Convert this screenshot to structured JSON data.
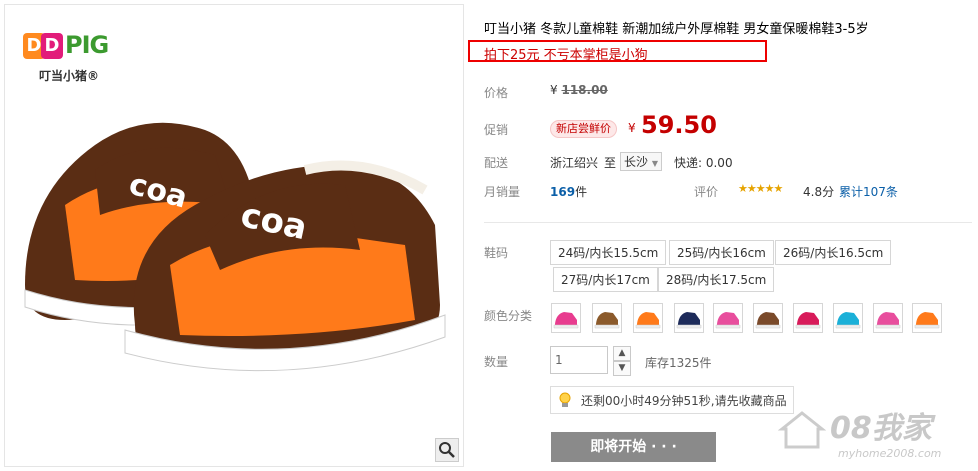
{
  "product": {
    "title": "叮当小猪 冬款儿童棉鞋 新潮加绒户外厚棉鞋 男女童保暖棉鞋3-5岁",
    "promo": "拍下25元 不亏本掌柜是小狗"
  },
  "brand": {
    "letters": "PIG",
    "subtitle": "叮当小猪",
    "reg": "®",
    "colors": {
      "d1": "#ff8a1f",
      "d2": "#e21c7a",
      "word": "#3c9a2f"
    }
  },
  "image": {
    "shoe_text": "coa"
  },
  "price": {
    "label": "价格",
    "currency": "¥",
    "original": "118.00"
  },
  "promo_price": {
    "label": "促销",
    "badge": "新店尝鲜价",
    "currency": "¥",
    "value": "59.50"
  },
  "shipping": {
    "label": "配送",
    "origin": "浙江绍兴",
    "to": "至",
    "destination": "长沙",
    "express": "快递: 0.00"
  },
  "sales": {
    "label": "月销量",
    "count": "169",
    "unit": "件",
    "rating_label": "评价",
    "stars": "★★★★★",
    "rating": "4.8分",
    "reviews": "累计107条"
  },
  "size": {
    "label": "鞋码",
    "options": [
      "24码/内长15.5cm",
      "25码/内长16cm",
      "26码/内长16.5cm",
      "27码/内长17cm",
      "28码/内长17.5cm"
    ]
  },
  "color": {
    "label": "颜色分类",
    "swatches": [
      "#e83c8f",
      "#8b5a2b",
      "#ff7a1a",
      "#1d2b5a",
      "#e84e9d",
      "#7a4a2a",
      "#d81b5a",
      "#1bb0d8",
      "#e84e9d",
      "#ff7a1a"
    ]
  },
  "quantity": {
    "label": "数量",
    "value": "1",
    "up": "▲",
    "down": "▼",
    "stock": "库存1325件"
  },
  "notice": {
    "text": "还剩00小时49分钟51秒,请先收藏商品"
  },
  "buy": {
    "label": "即将开始 · · ·"
  },
  "watermark": {
    "text": "08我家",
    "url": "myhome2008.com"
  },
  "colors": {
    "accent": "#c40000",
    "promo_border": "#e00000"
  }
}
